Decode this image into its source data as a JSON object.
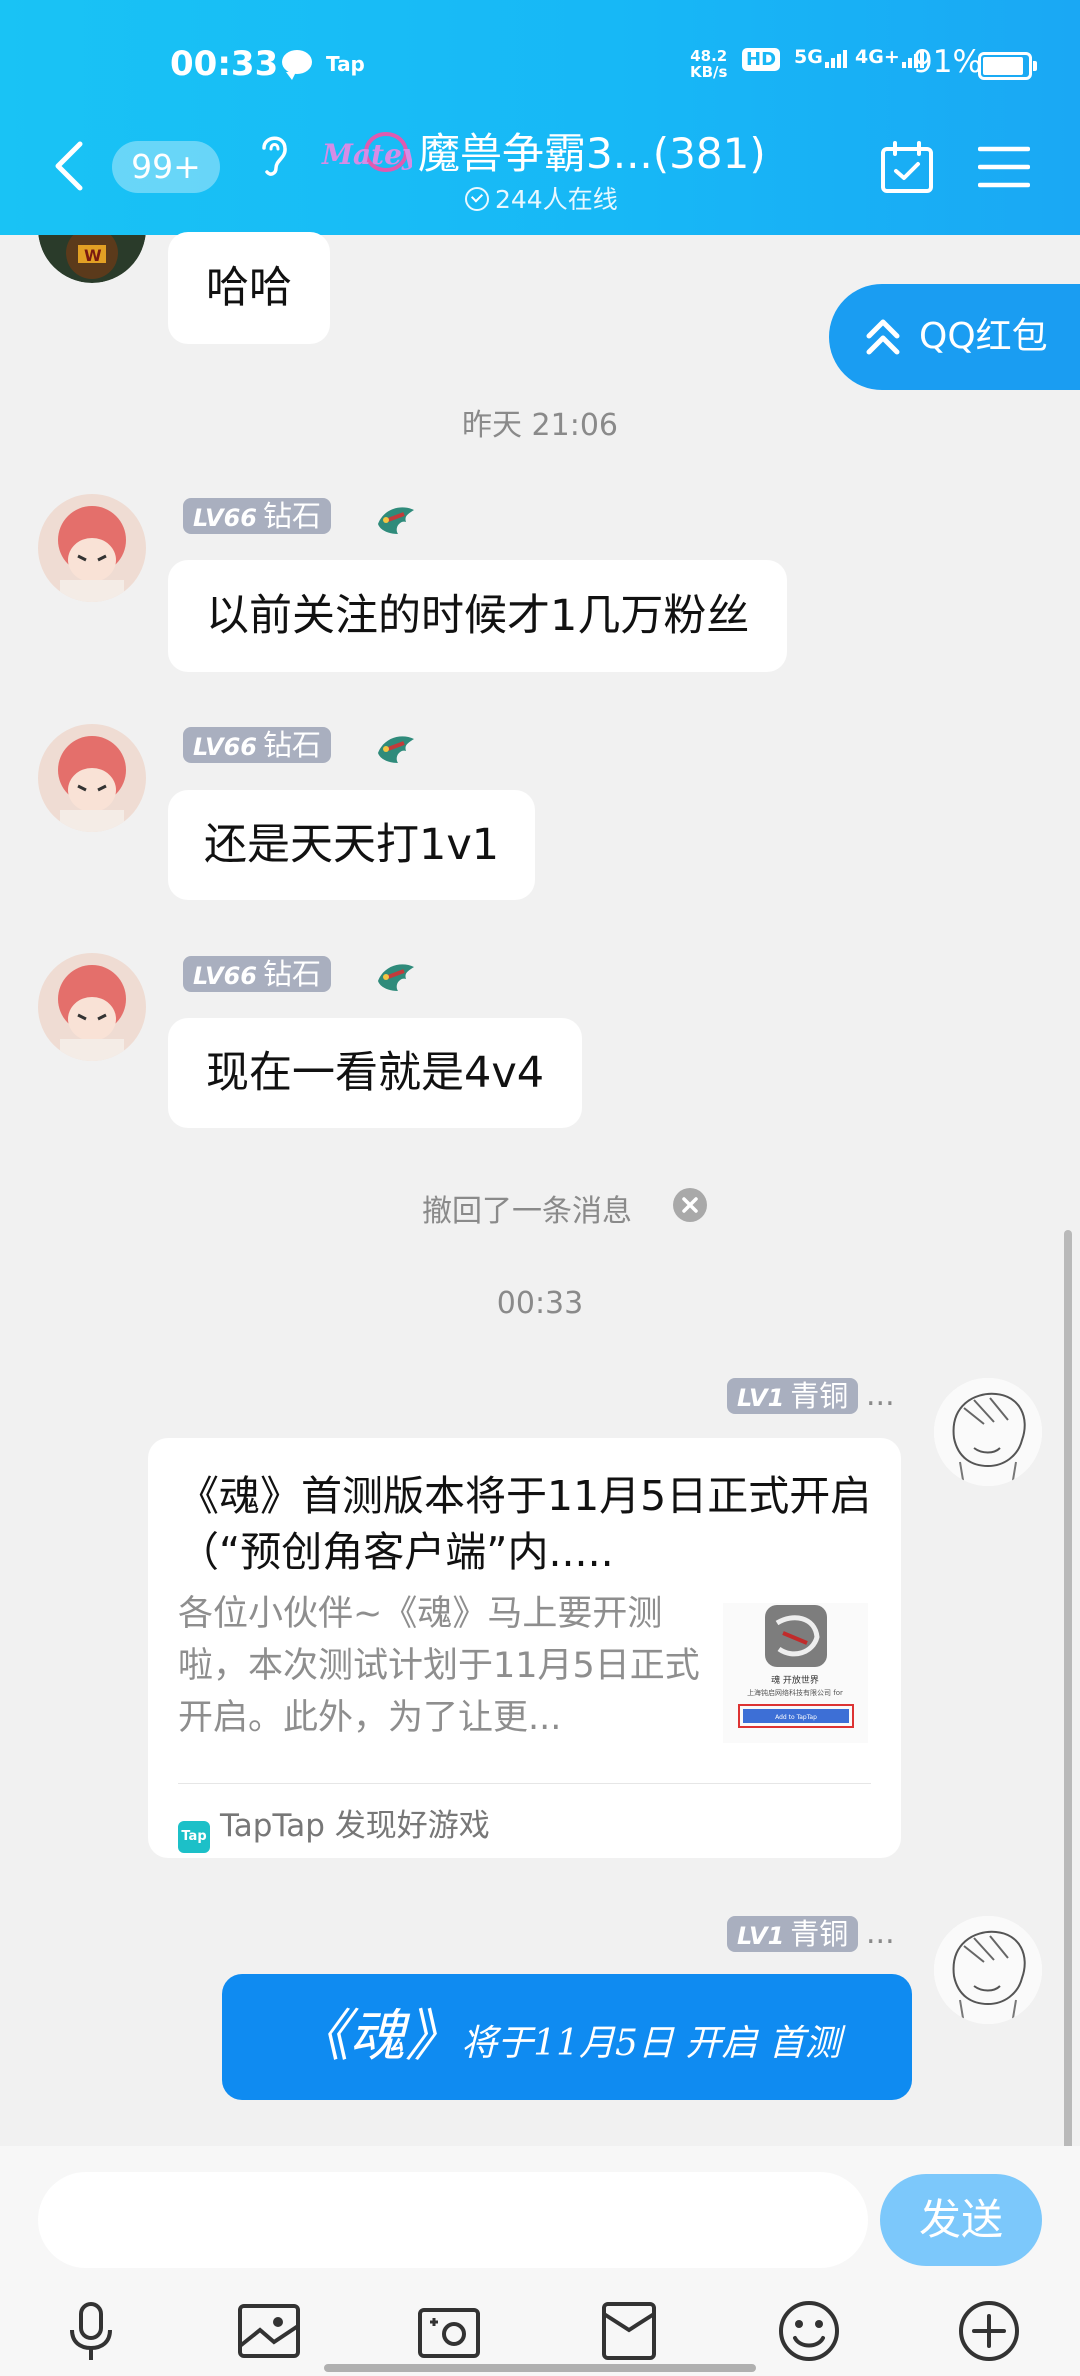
{
  "status_bar": {
    "time": "00:33",
    "notif_app": "Tap",
    "net_speed_top": "48.2",
    "net_speed_bottom": "KB/s",
    "hd": "HD",
    "net1": "5G",
    "net2": "4G+",
    "battery": "91%"
  },
  "header": {
    "unread_badge": "99+",
    "group_title": "魔兽争霸3...(381)",
    "online": "244人在线",
    "logo_text": "Matey"
  },
  "redpacket": {
    "label": "QQ红包"
  },
  "messages": {
    "m0": "哈哈",
    "ts1": "昨天 21:06",
    "m1": {
      "level": "LV66",
      "rank": "钻石",
      "text": "以前关注的时候才1几万粉丝"
    },
    "m2": {
      "level": "LV66",
      "rank": "钻石",
      "text": "还是天天打1v1"
    },
    "m3": {
      "level": "LV66",
      "rank": "钻石",
      "text": "现在一看就是4v4"
    },
    "recalled": "撤回了一条消息",
    "ts2": "00:33",
    "m4": {
      "level": "LV1",
      "rank": "青铜",
      "more": "...",
      "card_title": "《魂》首测版本将于11月5日正式开启（“预创角客户端”内.....",
      "card_desc": "各位小伙伴~《魂》马上要开测啦，本次测试计划于11月5日正式开启。此外，为了让更...",
      "card_source": "TapTap 发现好游戏",
      "tap_icon": "Tap",
      "thumb_title": "魂 开放世界",
      "thumb_company": "上海钝启网络科技有限公司 for",
      "thumb_button": "Add to TapTap"
    },
    "m5": {
      "level": "LV1",
      "rank": "青铜",
      "more": "...",
      "text_big": "《魂》",
      "text_small": "将于11月5日 开启 首测"
    }
  },
  "input": {
    "placeholder": "",
    "send_label": "发送"
  },
  "icons": [
    "mic-icon",
    "image-icon",
    "camera-icon",
    "file-icon",
    "emoji-icon",
    "plus-icon"
  ]
}
